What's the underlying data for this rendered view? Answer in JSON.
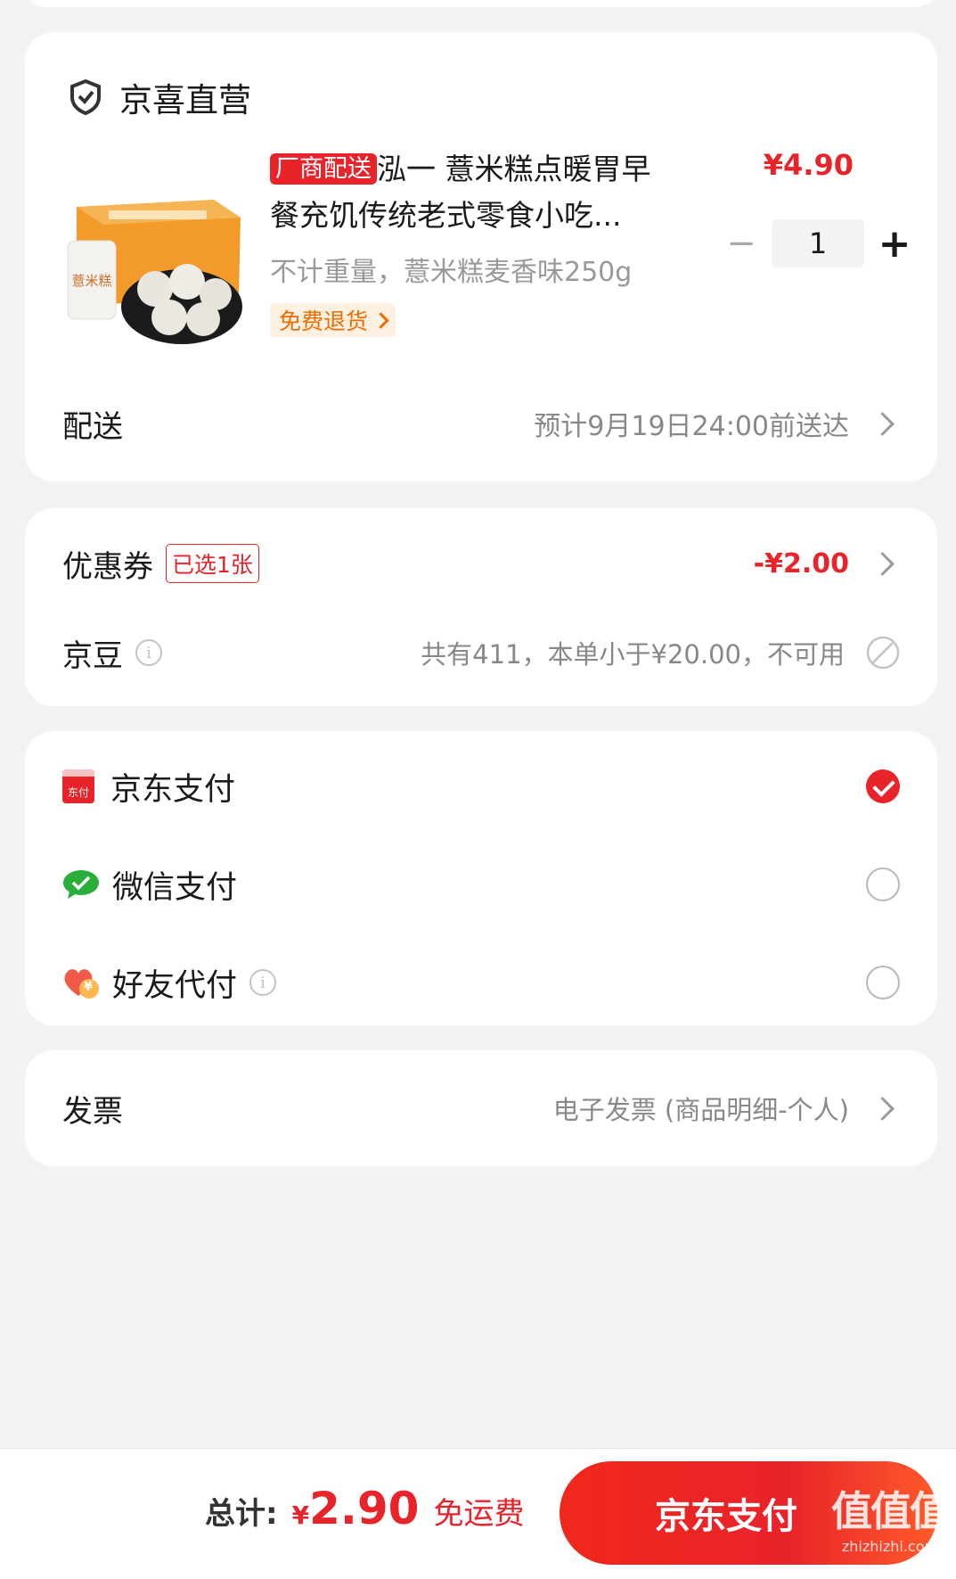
{
  "store": {
    "name": "京喜直营"
  },
  "product": {
    "tag": "厂商配送",
    "title_line1": "泓一 薏米糕点暖胃早",
    "title_line2": "餐充饥传统老式零食小吃...",
    "spec": "不计重量，薏米糕麦香味250g",
    "return_badge": "免费退货",
    "price": "¥4.90",
    "quantity": "1",
    "minus": "−",
    "plus": "+",
    "image_text": "薏米糕"
  },
  "delivery": {
    "label": "配送",
    "value": "预计9月19日24:00前送达"
  },
  "coupon": {
    "label": "优惠券",
    "badge": "已选1张",
    "value": "-¥2.00"
  },
  "jingdou": {
    "label": "京豆",
    "info": "i",
    "value": "共有411，本单小于¥20.00，不可用"
  },
  "payment": {
    "options": [
      {
        "icon_text": "东付",
        "label": "京东支付",
        "selected": true
      },
      {
        "label": "微信支付",
        "selected": false
      },
      {
        "icon_text": "¥",
        "label": "好友代付",
        "info": "i",
        "selected": false
      }
    ]
  },
  "invoice": {
    "label": "发票",
    "value": "电子发票 (商品明细-个人)"
  },
  "footer": {
    "total_label": "总计:",
    "currency": "¥",
    "total": "2.90",
    "shipping": "免运费",
    "pay_button": "京东支付",
    "watermark_main": "值值值",
    "watermark_url": "zhizhizhi.com"
  },
  "colors": {
    "accent": "#e8232a",
    "orange": "#ef6c00",
    "wechat": "#2aae3a"
  }
}
